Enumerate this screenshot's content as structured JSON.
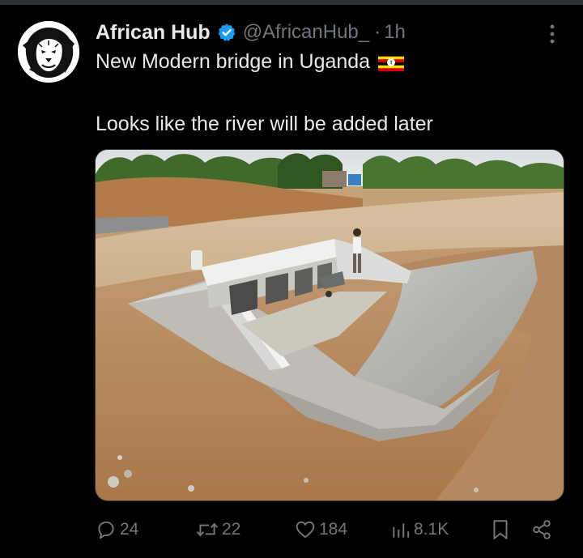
{
  "post": {
    "display_name": "African Hub",
    "handle": "@AfricanHub_",
    "separator": "·",
    "time": "1h",
    "text_line1": "New Modern bridge in Uganda",
    "text_line2": "Looks like the river will be added later"
  },
  "icons": {
    "verified": "verified-badge-icon",
    "more": "more-options-icon",
    "flag": "uganda-flag",
    "reply": "reply-icon",
    "repost": "repost-icon",
    "like": "like-icon",
    "views": "views-icon",
    "bookmark": "bookmark-icon",
    "share": "share-icon"
  },
  "actions": {
    "replies": "24",
    "reposts": "22",
    "likes": "184",
    "views": "8.1K"
  },
  "colors": {
    "background": "#000000",
    "primary_text": "#e7e9ea",
    "secondary_text": "#71767b",
    "verified_blue": "#1d9bf0"
  }
}
